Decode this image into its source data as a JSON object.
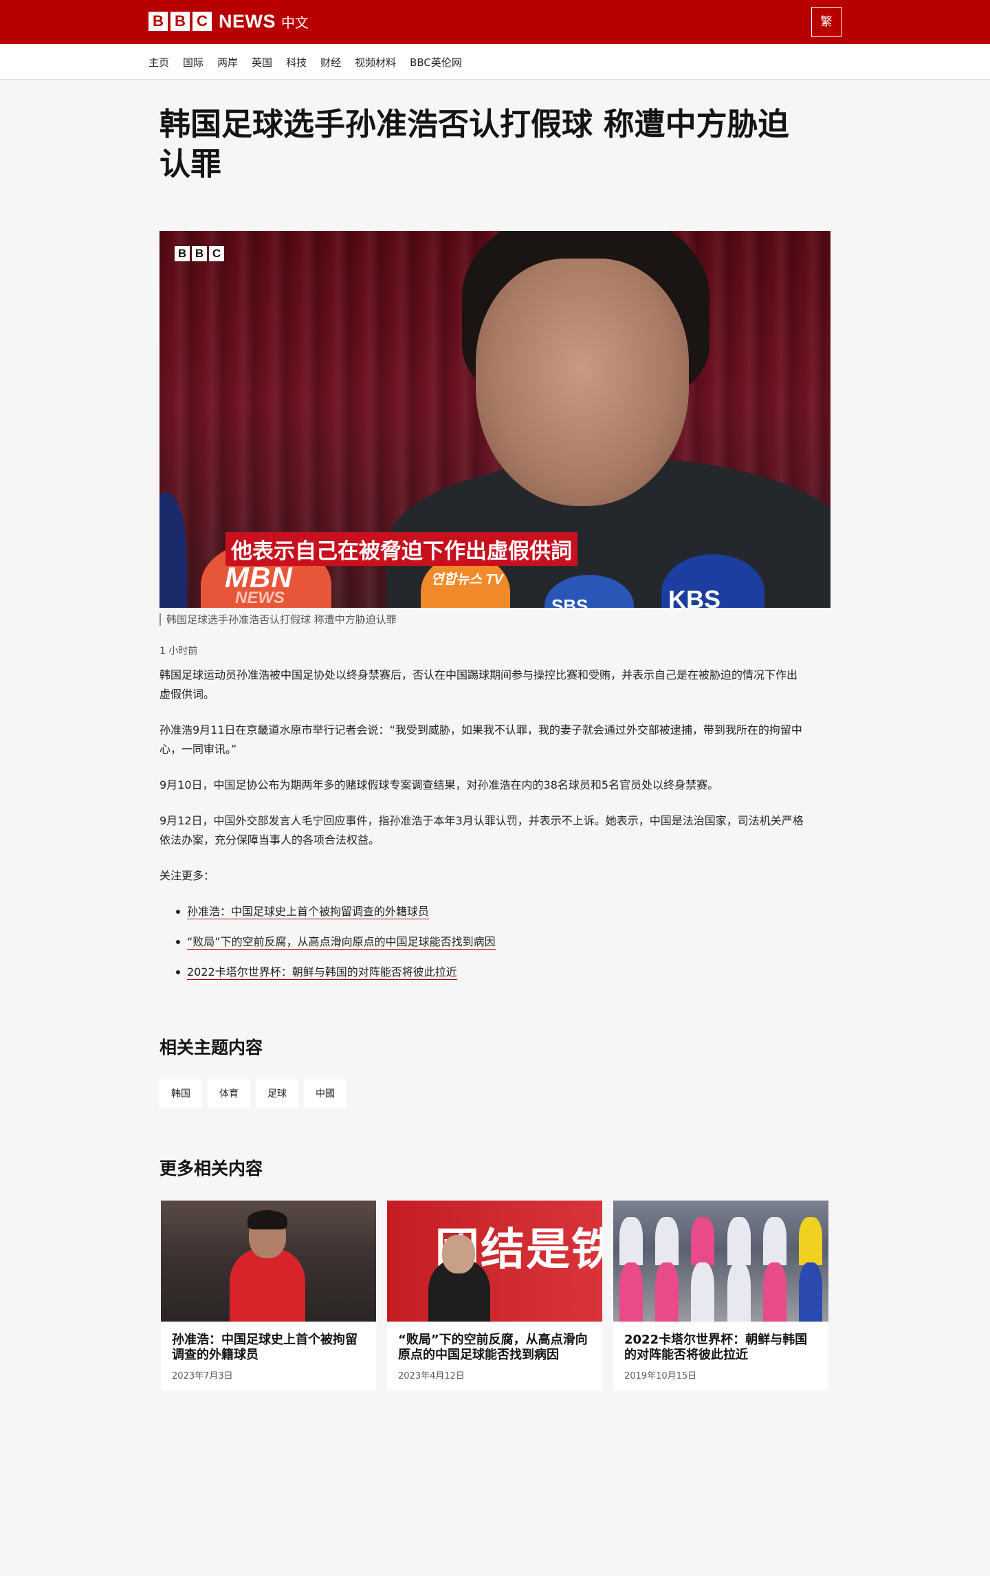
{
  "header": {
    "logo_letters": [
      "B",
      "B",
      "C"
    ],
    "logo_news": "NEWS",
    "logo_lang": "中文",
    "trad_button": "繁",
    "brand_color": "#b80000"
  },
  "nav": {
    "items": [
      "主页",
      "国际",
      "两岸",
      "英国",
      "科技",
      "财经",
      "视频材料",
      "BBC英伦网"
    ]
  },
  "article": {
    "headline": "韩国足球选手孙准浩否认打假球 称遭中方胁迫认罪",
    "hero": {
      "watermark_letters": [
        "B",
        "B",
        "C"
      ],
      "subtitle_overlay": "他表示自己在被脅迫下作出虛假供詞",
      "mic_labels": {
        "mbn": "MBN",
        "mbn_sub": "NEWS",
        "yonhap": "연합뉴스 TV",
        "sbs": "SBS",
        "kbs": "KBS"
      }
    },
    "caption": "韩国足球选手孙准浩否认打假球 称遭中方胁迫认罪",
    "timestamp": "1 小时前",
    "paragraphs": [
      "韩国足球运动员孙准浩被中国足协处以终身禁赛后，否认在中国踢球期间参与操控比赛和受贿，并表示自己是在被胁迫的情况下作出虚假供词。",
      "孙准浩9月11日在京畿道水原市举行记者会说：“我受到威胁，如果我不认罪，我的妻子就会通过外交部被逮捕，带到我所在的拘留中心，一同审讯。”",
      "9月10日，中国足协公布为期两年多的赌球假球专案调查结果，对孙准浩在内的38名球员和5名官员处以终身禁赛。",
      "9月12日，中国外交部发言人毛宁回应事件，指孙准浩于本年3月认罪认罚，并表示不上诉。她表示，中国是法治国家，司法机关严格依法办案，充分保障当事人的各项合法权益。",
      "关注更多："
    ],
    "more_links": [
      "孙准浩：中国足球史上首个被拘留调查的外籍球员",
      "“败局”下的空前反腐，从高点滑向原点的中国足球能否找到病因",
      "2022卡塔尔世界杯：朝鲜与韩国的对阵能否将彼此拉近"
    ]
  },
  "related_topics": {
    "title": "相关主题内容",
    "tags": [
      "韩国",
      "体育",
      "足球",
      "中國"
    ]
  },
  "more_related": {
    "title": "更多相关内容",
    "cards": [
      {
        "title": "孙准浩：中国足球史上首个被拘留调查的外籍球员",
        "date": "2023年7月3日"
      },
      {
        "title": "“败局”下的空前反腐，从高点滑向原点的中国足球能否找到病因",
        "date": "2023年4月12日",
        "image_text": "团结是铁"
      },
      {
        "title": "2022卡塔尔世界杯：朝鲜与韩国的对阵能否将彼此拉近",
        "date": "2019年10月15日"
      }
    ]
  }
}
